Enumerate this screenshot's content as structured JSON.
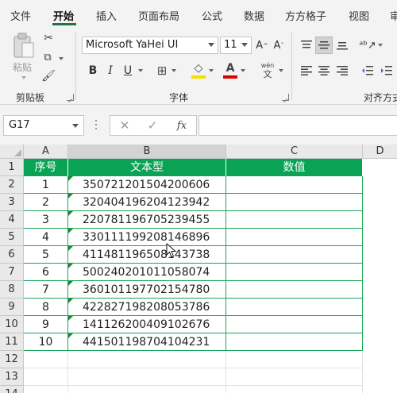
{
  "ribbon_tabs": [
    "文件",
    "开始",
    "插入",
    "页面布局",
    "公式",
    "数据",
    "方方格子",
    "视图",
    "审"
  ],
  "active_tab": "开始",
  "clipboard": {
    "paste_label": "粘贴",
    "group_label": "剪贴板"
  },
  "font": {
    "name": "Microsoft YaHei UI",
    "size": "11",
    "group_label": "字体",
    "bold": "B",
    "italic": "I",
    "underline": "U",
    "wen_top": "wén",
    "wen_bottom": "文"
  },
  "alignment": {
    "group_label": "对齐方式"
  },
  "formula_bar": {
    "cell_ref": "G17",
    "cancel": "✕",
    "enter": "✓",
    "fx": "fx",
    "value": ""
  },
  "columns": [
    "A",
    "B",
    "C",
    "D"
  ],
  "rows": [
    "1",
    "2",
    "3",
    "4",
    "5",
    "6",
    "7",
    "8",
    "9",
    "10",
    "11",
    "12",
    "13",
    "14"
  ],
  "table": {
    "headers": [
      "序号",
      "文本型",
      "数值"
    ],
    "data": [
      [
        "1",
        "350721201504200606",
        ""
      ],
      [
        "2",
        "320404196204123942",
        ""
      ],
      [
        "3",
        "220781196705239455",
        ""
      ],
      [
        "4",
        "330111199208146896",
        ""
      ],
      [
        "5",
        "411481196508143738",
        ""
      ],
      [
        "6",
        "500240201011058074",
        ""
      ],
      [
        "7",
        "360101197702154780",
        ""
      ],
      [
        "8",
        "422827198208053786",
        ""
      ],
      [
        "9",
        "141126200409102676",
        ""
      ],
      [
        "10",
        "441501198704104231",
        ""
      ]
    ]
  },
  "colors": {
    "header_green": "#0aa356",
    "accent": "#217346",
    "font_color": "#e00000",
    "highlight": "#f5e000"
  }
}
